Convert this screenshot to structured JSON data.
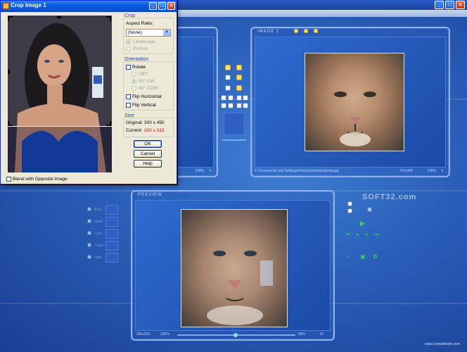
{
  "dialog": {
    "title": "Crop Image 1",
    "crop_group_label": "Crop",
    "aspect_ratio_label": "Aspect Ratio:",
    "aspect_ratio_value": "(None)",
    "landscape_label": "Landscape",
    "portrait_label": "Portrait",
    "orientation_group_label": "Orientation",
    "rotate_label": "Rotate",
    "rot180_label": "180°",
    "rot90cw_label": "90° CW",
    "rot90ccw_label": "90° CCW",
    "flip_horizontal_label": "Flip Horizontal",
    "flip_vertical_label": "Flip Vertical",
    "size_group_label": "Size",
    "original_label": "Original:",
    "original_value": "300 x 450",
    "current_label": "Current:",
    "current_value": "300 x 315",
    "ok_label": "OK",
    "cancel_label": "Cancel",
    "help_label": "Help",
    "blend_label": "Blend with Opposite Image"
  },
  "image1": {
    "zoom": "100%"
  },
  "image2": {
    "title": "IMAGE 2",
    "path": "C:\\Documents and Settings\\Heros\\Desktop\\animal.jpg",
    "dimensions": "276x300",
    "zoom": "100%"
  },
  "preview": {
    "title": "PREVIEW",
    "dimensions": "300x315",
    "zoom": "100%",
    "percent": "50%",
    "frame": "15"
  },
  "effects": [
    "Back",
    "Mask",
    "Color",
    "Trans",
    "Light"
  ],
  "watermark": "SOFT32.com",
  "footer_url": "www.FantaMorph.com",
  "colors": {
    "background": "#2a5fb8",
    "dialog_bg": "#ece9d8",
    "current_value": "#d01010",
    "accent_green": "#3bd057"
  }
}
